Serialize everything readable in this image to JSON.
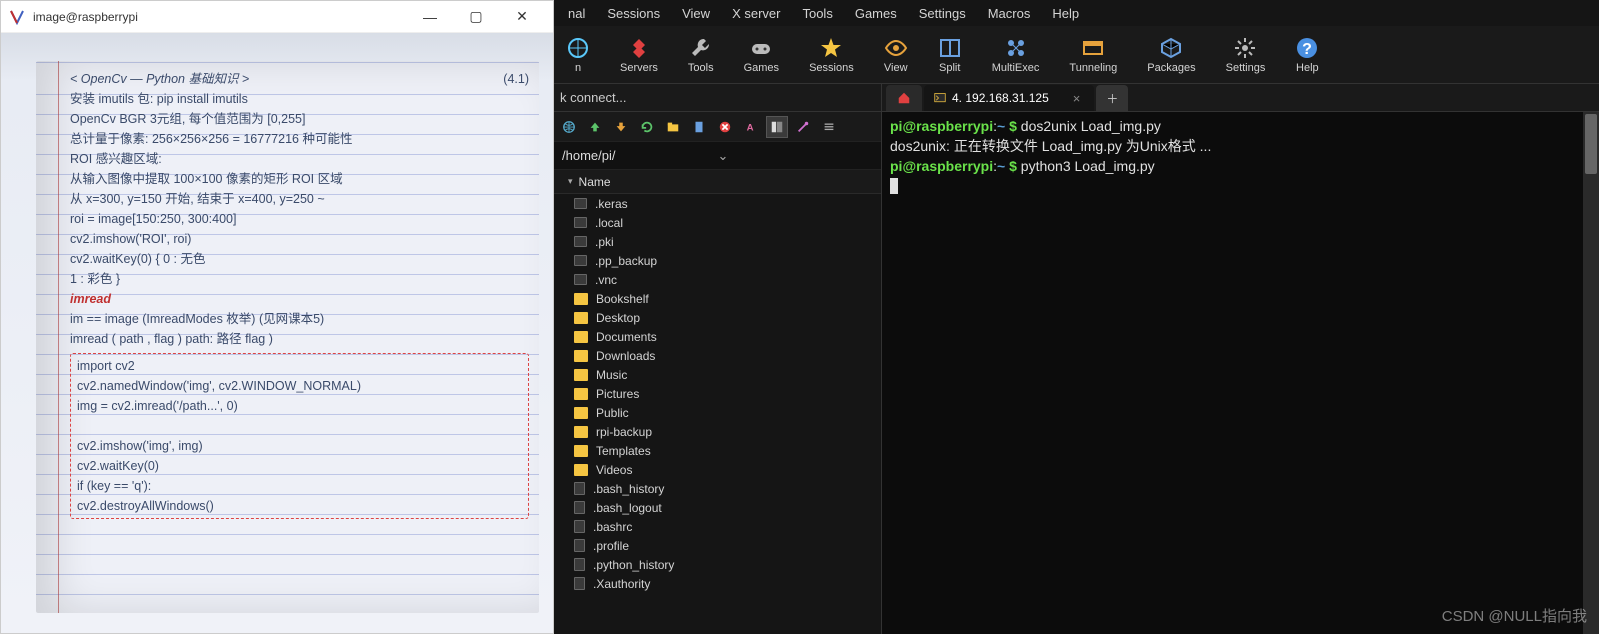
{
  "imgwin": {
    "title": "image@raspberrypi",
    "handwriting": {
      "title": "< OpenCv — Python 基础知识 >",
      "page": "(4.1)",
      "lines": [
        "安装 imutils 包:   pip install imutils",
        "OpenCv BGR 3元组, 每个值范围为 [0,255]",
        "总计量于像素: 256×256×256 = 16777216 种可能性",
        "ROI 感兴趣区域:",
        "   从输入图像中提取 100×100 像素的矩形 ROI 区域",
        "   从 x=300, y=150 开始, 结束于 x=400, y=250  ~",
        "      roi = image[150:250, 300:400]",
        "      cv2.imshow('ROI', roi)",
        "      cv2.waitKey(0)                      { 0 : 无色",
        "                                                     1 : 彩色 }"
      ],
      "imread_label": "imread",
      "imread_lines": [
        "im == image             (ImreadModes 枚举)    (见网课本5)",
        "imread ( path , flag )      path: 路径   flag )"
      ],
      "dashed_lines": [
        "import cv2",
        "cv2.namedWindow('img', cv2.WINDOW_NORMAL)",
        "img = cv2.imread('/path...', 0)",
        "",
        "cv2.imshow('img', img)",
        "cv2.waitKey(0)",
        "if (key == 'q'):",
        "cv2.destroyAllWindows()"
      ]
    }
  },
  "menu": [
    "nal",
    "Sessions",
    "View",
    "X server",
    "Tools",
    "Games",
    "Settings",
    "Macros",
    "Help"
  ],
  "toolbar": [
    {
      "label": "n",
      "icon": "session"
    },
    {
      "label": "Servers",
      "icon": "servers"
    },
    {
      "label": "Tools",
      "icon": "tools"
    },
    {
      "label": "Games",
      "icon": "games"
    },
    {
      "label": "Sessions",
      "icon": "sessions"
    },
    {
      "label": "View",
      "icon": "view"
    },
    {
      "label": "Split",
      "icon": "split"
    },
    {
      "label": "MultiExec",
      "icon": "multiexec"
    },
    {
      "label": "Tunneling",
      "icon": "tunneling"
    },
    {
      "label": "Packages",
      "icon": "packages"
    },
    {
      "label": "Settings",
      "icon": "settings"
    },
    {
      "label": "Help",
      "icon": "help"
    }
  ],
  "quickconnect": "k connect...",
  "path": "/home/pi/",
  "colhead": "Name",
  "files": [
    {
      "name": ".keras",
      "t": "hfolder"
    },
    {
      "name": ".local",
      "t": "hfolder"
    },
    {
      "name": ".pki",
      "t": "hfolder"
    },
    {
      "name": ".pp_backup",
      "t": "hfolder"
    },
    {
      "name": ".vnc",
      "t": "hfolder"
    },
    {
      "name": "Bookshelf",
      "t": "folder"
    },
    {
      "name": "Desktop",
      "t": "folder"
    },
    {
      "name": "Documents",
      "t": "folder"
    },
    {
      "name": "Downloads",
      "t": "folder"
    },
    {
      "name": "Music",
      "t": "folder"
    },
    {
      "name": "Pictures",
      "t": "folder"
    },
    {
      "name": "Public",
      "t": "folder"
    },
    {
      "name": "rpi-backup",
      "t": "folder"
    },
    {
      "name": "Templates",
      "t": "folder"
    },
    {
      "name": "Videos",
      "t": "folder"
    },
    {
      "name": ".bash_history",
      "t": "hfile"
    },
    {
      "name": ".bash_logout",
      "t": "hfile"
    },
    {
      "name": ".bashrc",
      "t": "hfile"
    },
    {
      "name": ".profile",
      "t": "hfile"
    },
    {
      "name": ".python_history",
      "t": "hfile"
    },
    {
      "name": ".Xauthority",
      "t": "hfile"
    }
  ],
  "tabs": {
    "active": "4. 192.168.31.125"
  },
  "term": {
    "prompt_user": "pi@raspberrypi",
    "prompt_path": "~",
    "prompt_sym": "$",
    "line1_cmd": "dos2unix Load_img.py",
    "line2": "dos2unix: 正在转换文件 Load_img.py 为Unix格式 ...",
    "line3_cmd": "python3 Load_img.py"
  },
  "watermark": "CSDN @NULL指向我"
}
